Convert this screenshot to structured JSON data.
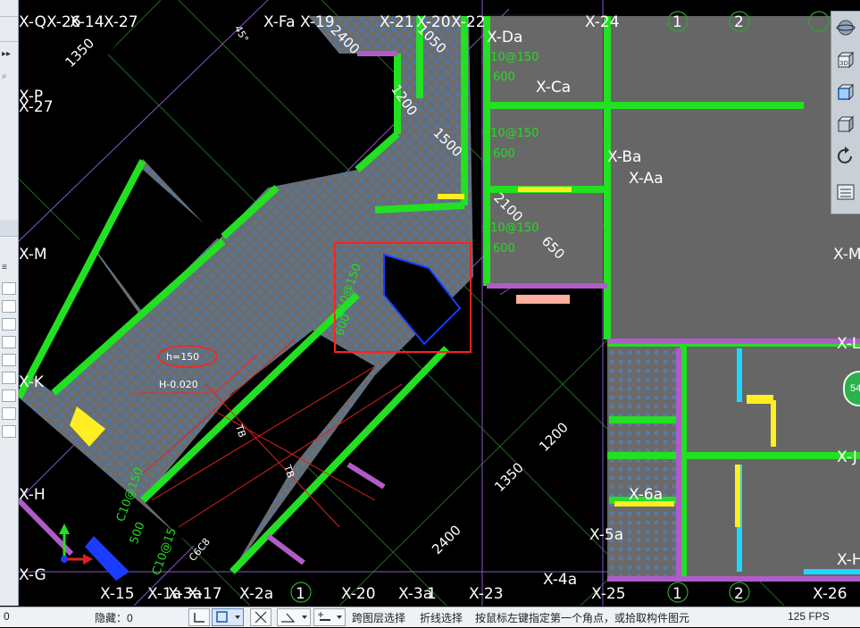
{
  "left_panel": {
    "icons": [
      "▸▸",
      "⌕",
      "≡"
    ]
  },
  "grid_labels": {
    "top": [
      "X-Q",
      "X-26",
      "X-14",
      "X-27",
      "X-Fa",
      "X-19",
      "X-21",
      "X-20",
      "X-22",
      "X-24",
      "1",
      "2"
    ],
    "left": [
      "X-P",
      "X-27",
      "X-M",
      "X-K",
      "X-H",
      "X-G"
    ],
    "bottom": [
      "X-15",
      "X-1a",
      "X-3a",
      "X-17",
      "X-2a",
      "1",
      "X-20",
      "X-3a",
      "1",
      "X-23",
      "X-4a",
      "X-25",
      "1",
      "2",
      "X-26"
    ],
    "right": [
      "X-M",
      "X-L",
      "X-J",
      "X-H"
    ],
    "inner": [
      "X-Da",
      "X-Ca",
      "X-Ba",
      "X-Aa",
      "X-6a",
      "X-5a"
    ]
  },
  "dimensions": [
    "1350",
    "2400",
    "1200",
    "1500",
    "2100",
    "650",
    "1200",
    "1350",
    "2400",
    "45°",
    "1050"
  ],
  "rebar_labels": [
    "C10@150",
    "600",
    "C10@150",
    "600",
    "C10@150",
    "600",
    "C10@150",
    "600",
    "C10@150",
    "500",
    "C10@15",
    "C6C8"
  ],
  "annotations": {
    "slab_thickness": "h=150",
    "elevation": "H-0.020",
    "beam_tag": "TB"
  },
  "view_toolbar": {
    "items": [
      "globe-icon",
      "3d-view-icon",
      "box-icon",
      "cube-icon",
      "rotate-icon",
      "layers-icon"
    ],
    "label_3d": "3D"
  },
  "badge": {
    "text": "54"
  },
  "status": {
    "coordinate": "0",
    "hidden_label": "隐藏：0",
    "cross_layer_select": "跨图层选择",
    "polyline_select": "折线选择",
    "prompt": "按鼠标左键指定第一个角点，或拾取构件图元",
    "fps": "125 FPS"
  }
}
